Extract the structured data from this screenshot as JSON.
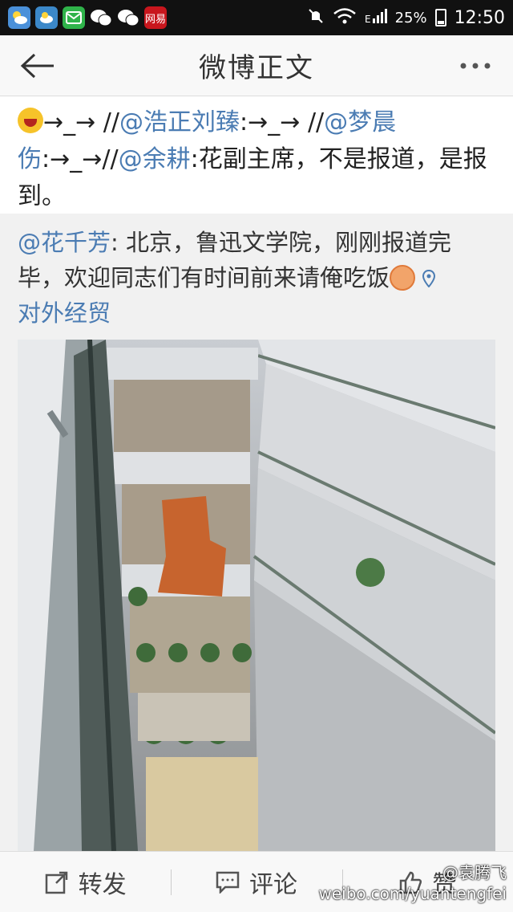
{
  "statusbar": {
    "apps": [
      {
        "icon": "weather-sun-cloud-icon",
        "color": "#4a90d9"
      },
      {
        "icon": "weather-app-icon",
        "color": "#3b88c9"
      },
      {
        "icon": "message-icon",
        "color": "#2fb34a"
      },
      {
        "icon": "wechat-icon",
        "color": "#39b54a"
      },
      {
        "icon": "wechat-icon",
        "color": "#39b54a"
      },
      {
        "icon": "netease-news-icon",
        "color": "#c8161d",
        "label": "网易"
      }
    ],
    "battery": "25%",
    "time": "12:50"
  },
  "titlebar": {
    "title": "微博正文"
  },
  "repost": {
    "arrow1": "→_→ //",
    "user1": "@浩正刘臻",
    "arrow2": ":→_→ //",
    "user2": "@梦晨伤",
    "arrow3": ":→_→//",
    "user3": "@余耕",
    "text": ":花副主席，不是报道，是报到。"
  },
  "original": {
    "author": "@花千芳",
    "text": ": 北京，鲁迅文学院，刚刚报道完毕，欢迎同志们有时间前来请俺吃饭",
    "location": "对外经贸"
  },
  "actions": {
    "repost": "转发",
    "comment": "评论",
    "like": "赞"
  },
  "watermark": {
    "handle": "@袁腾飞",
    "url": "weibo.com/yuantengfei"
  },
  "colors": {
    "link": "#4b7cb3"
  }
}
